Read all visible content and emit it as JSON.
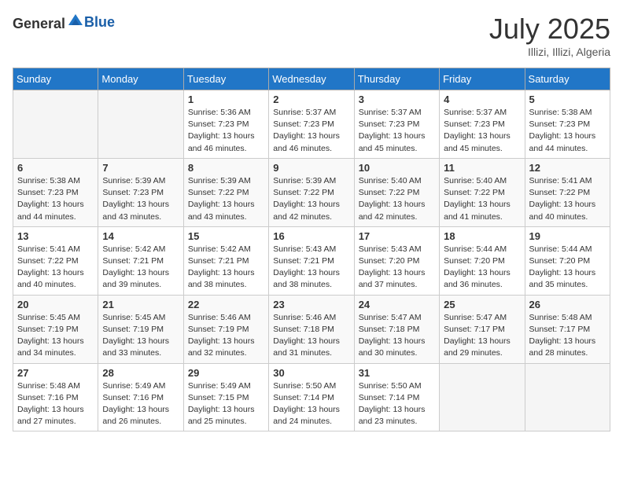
{
  "header": {
    "logo_general": "General",
    "logo_blue": "Blue",
    "title": "July 2025",
    "location": "Illizi, Illizi, Algeria"
  },
  "calendar": {
    "days_of_week": [
      "Sunday",
      "Monday",
      "Tuesday",
      "Wednesday",
      "Thursday",
      "Friday",
      "Saturday"
    ],
    "weeks": [
      [
        {
          "day": "",
          "info": ""
        },
        {
          "day": "",
          "info": ""
        },
        {
          "day": "1",
          "info": "Sunrise: 5:36 AM\nSunset: 7:23 PM\nDaylight: 13 hours and 46 minutes."
        },
        {
          "day": "2",
          "info": "Sunrise: 5:37 AM\nSunset: 7:23 PM\nDaylight: 13 hours and 46 minutes."
        },
        {
          "day": "3",
          "info": "Sunrise: 5:37 AM\nSunset: 7:23 PM\nDaylight: 13 hours and 45 minutes."
        },
        {
          "day": "4",
          "info": "Sunrise: 5:37 AM\nSunset: 7:23 PM\nDaylight: 13 hours and 45 minutes."
        },
        {
          "day": "5",
          "info": "Sunrise: 5:38 AM\nSunset: 7:23 PM\nDaylight: 13 hours and 44 minutes."
        }
      ],
      [
        {
          "day": "6",
          "info": "Sunrise: 5:38 AM\nSunset: 7:23 PM\nDaylight: 13 hours and 44 minutes."
        },
        {
          "day": "7",
          "info": "Sunrise: 5:39 AM\nSunset: 7:23 PM\nDaylight: 13 hours and 43 minutes."
        },
        {
          "day": "8",
          "info": "Sunrise: 5:39 AM\nSunset: 7:22 PM\nDaylight: 13 hours and 43 minutes."
        },
        {
          "day": "9",
          "info": "Sunrise: 5:39 AM\nSunset: 7:22 PM\nDaylight: 13 hours and 42 minutes."
        },
        {
          "day": "10",
          "info": "Sunrise: 5:40 AM\nSunset: 7:22 PM\nDaylight: 13 hours and 42 minutes."
        },
        {
          "day": "11",
          "info": "Sunrise: 5:40 AM\nSunset: 7:22 PM\nDaylight: 13 hours and 41 minutes."
        },
        {
          "day": "12",
          "info": "Sunrise: 5:41 AM\nSunset: 7:22 PM\nDaylight: 13 hours and 40 minutes."
        }
      ],
      [
        {
          "day": "13",
          "info": "Sunrise: 5:41 AM\nSunset: 7:22 PM\nDaylight: 13 hours and 40 minutes."
        },
        {
          "day": "14",
          "info": "Sunrise: 5:42 AM\nSunset: 7:21 PM\nDaylight: 13 hours and 39 minutes."
        },
        {
          "day": "15",
          "info": "Sunrise: 5:42 AM\nSunset: 7:21 PM\nDaylight: 13 hours and 38 minutes."
        },
        {
          "day": "16",
          "info": "Sunrise: 5:43 AM\nSunset: 7:21 PM\nDaylight: 13 hours and 38 minutes."
        },
        {
          "day": "17",
          "info": "Sunrise: 5:43 AM\nSunset: 7:20 PM\nDaylight: 13 hours and 37 minutes."
        },
        {
          "day": "18",
          "info": "Sunrise: 5:44 AM\nSunset: 7:20 PM\nDaylight: 13 hours and 36 minutes."
        },
        {
          "day": "19",
          "info": "Sunrise: 5:44 AM\nSunset: 7:20 PM\nDaylight: 13 hours and 35 minutes."
        }
      ],
      [
        {
          "day": "20",
          "info": "Sunrise: 5:45 AM\nSunset: 7:19 PM\nDaylight: 13 hours and 34 minutes."
        },
        {
          "day": "21",
          "info": "Sunrise: 5:45 AM\nSunset: 7:19 PM\nDaylight: 13 hours and 33 minutes."
        },
        {
          "day": "22",
          "info": "Sunrise: 5:46 AM\nSunset: 7:19 PM\nDaylight: 13 hours and 32 minutes."
        },
        {
          "day": "23",
          "info": "Sunrise: 5:46 AM\nSunset: 7:18 PM\nDaylight: 13 hours and 31 minutes."
        },
        {
          "day": "24",
          "info": "Sunrise: 5:47 AM\nSunset: 7:18 PM\nDaylight: 13 hours and 30 minutes."
        },
        {
          "day": "25",
          "info": "Sunrise: 5:47 AM\nSunset: 7:17 PM\nDaylight: 13 hours and 29 minutes."
        },
        {
          "day": "26",
          "info": "Sunrise: 5:48 AM\nSunset: 7:17 PM\nDaylight: 13 hours and 28 minutes."
        }
      ],
      [
        {
          "day": "27",
          "info": "Sunrise: 5:48 AM\nSunset: 7:16 PM\nDaylight: 13 hours and 27 minutes."
        },
        {
          "day": "28",
          "info": "Sunrise: 5:49 AM\nSunset: 7:16 PM\nDaylight: 13 hours and 26 minutes."
        },
        {
          "day": "29",
          "info": "Sunrise: 5:49 AM\nSunset: 7:15 PM\nDaylight: 13 hours and 25 minutes."
        },
        {
          "day": "30",
          "info": "Sunrise: 5:50 AM\nSunset: 7:14 PM\nDaylight: 13 hours and 24 minutes."
        },
        {
          "day": "31",
          "info": "Sunrise: 5:50 AM\nSunset: 7:14 PM\nDaylight: 13 hours and 23 minutes."
        },
        {
          "day": "",
          "info": ""
        },
        {
          "day": "",
          "info": ""
        }
      ]
    ]
  }
}
